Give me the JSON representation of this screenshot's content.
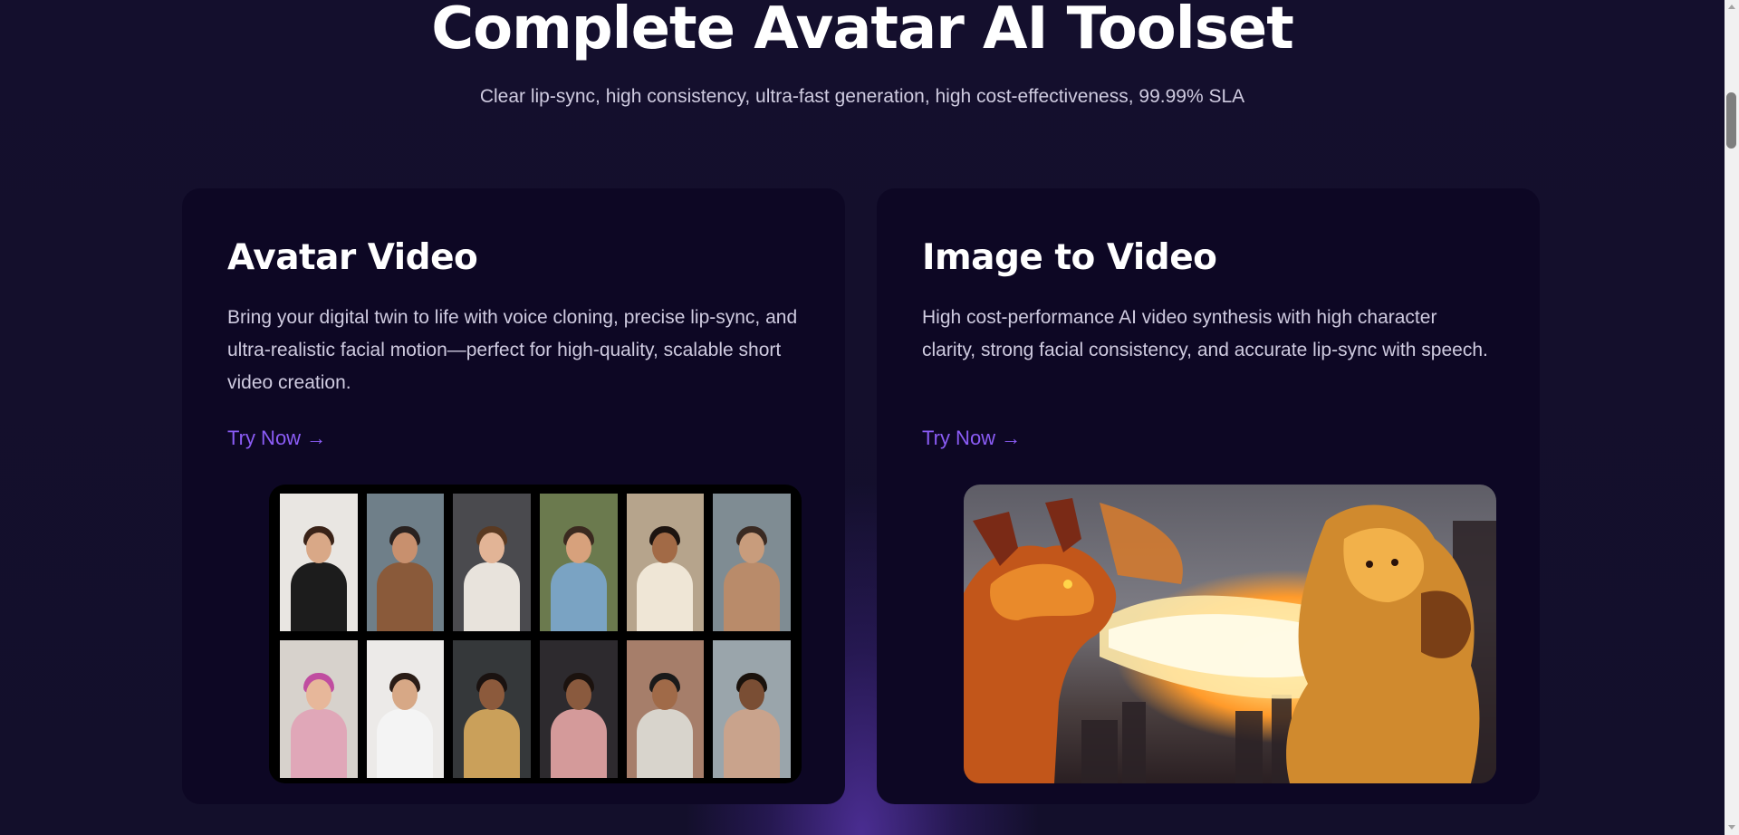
{
  "hero": {
    "title": "Complete Avatar AI Toolset",
    "subtitle": "Clear lip-sync, high consistency, ultra-fast generation, high cost-effectiveness, 99.99% SLA"
  },
  "cards": [
    {
      "title": "Avatar Video",
      "description": "Bring your digital twin to life with voice cloning, precise lip-sync, and ultra-realistic facial motion—perfect for high-quality, scalable short video creation.",
      "cta": "Try Now →"
    },
    {
      "title": "Image to Video",
      "description": "High cost-performance AI video synthesis with high character clarity, strong facial consistency, and accurate lip-sync with speech.",
      "cta": "Try Now →"
    }
  ],
  "colors": {
    "background": "#130f2b",
    "card": "#0d0724",
    "accent": "#8b5cf6",
    "glow": "#7846e6"
  },
  "avatar_tiles": [
    {
      "bg": "#e9e6e2",
      "skin": "#d9a887",
      "hair": "#3a2318",
      "cloth": "#1c1c1c"
    },
    {
      "bg": "#6f7f89",
      "skin": "#c8906e",
      "hair": "#2a2220",
      "cloth": "#8a5a3a"
    },
    {
      "bg": "#4a4a4e",
      "skin": "#e2b496",
      "hair": "#5a3a22",
      "cloth": "#e8e3dc"
    },
    {
      "bg": "#6b7a4e",
      "skin": "#d7a17c",
      "hair": "#3b2a20",
      "cloth": "#7aa3c3"
    },
    {
      "bg": "#b6a48c",
      "skin": "#a26a46",
      "hair": "#1d1410",
      "cloth": "#efe6d6"
    },
    {
      "bg": "#7f8c93",
      "skin": "#c89c7c",
      "hair": "#3a2a22",
      "cloth": "#b98b6a"
    },
    {
      "bg": "#d7d2cc",
      "skin": "#e7b79a",
      "hair": "#c04da0",
      "cloth": "#e0a7b8"
    },
    {
      "bg": "#eceae8",
      "skin": "#d7a886",
      "hair": "#2a1c16",
      "cloth": "#f4f4f4"
    },
    {
      "bg": "#35383a",
      "skin": "#8c5a3c",
      "hair": "#1a1210",
      "cloth": "#caa05a"
    },
    {
      "bg": "#2d2a2e",
      "skin": "#8a5a3e",
      "hair": "#1b120e",
      "cloth": "#d49a9a"
    },
    {
      "bg": "#a67e6a",
      "skin": "#a06a48",
      "hair": "#1a1a1a",
      "cloth": "#d8d4cc"
    },
    {
      "bg": "#9aa5ab",
      "skin": "#7a4e34",
      "hair": "#1a120c",
      "cloth": "#c9a38c"
    }
  ]
}
